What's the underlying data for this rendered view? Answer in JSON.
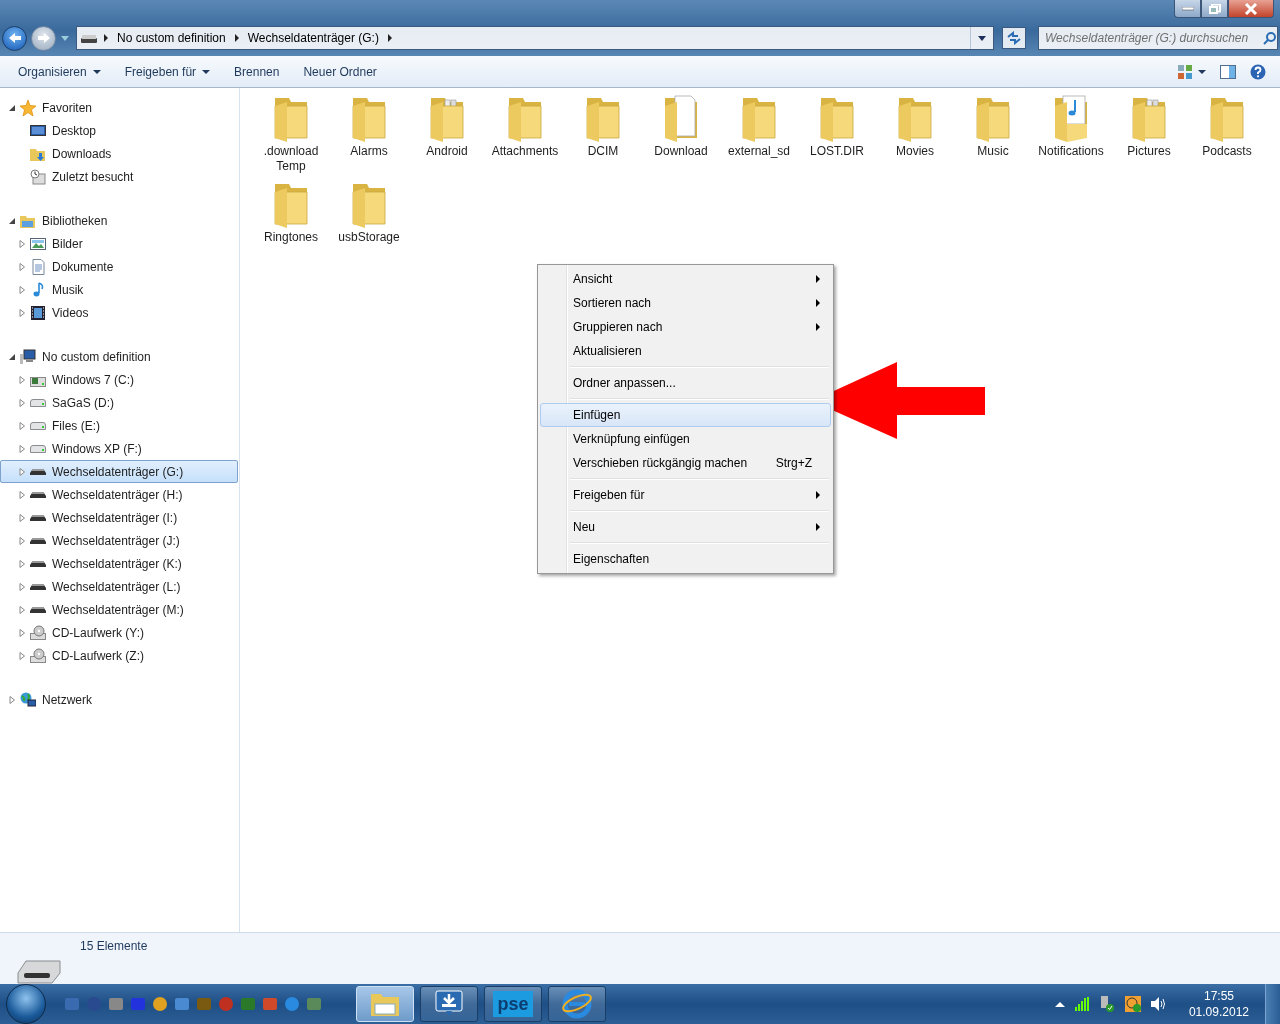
{
  "address_bar": {
    "segments": [
      "No custom definition",
      "Wechseldatenträger (G:)"
    ]
  },
  "search": {
    "placeholder": "Wechseldatenträger (G:) durchsuchen"
  },
  "toolbar": {
    "buttons": [
      {
        "label": "Organisieren",
        "dropdown": true
      },
      {
        "label": "Freigeben für",
        "dropdown": true
      },
      {
        "label": "Brennen",
        "dropdown": false
      },
      {
        "label": "Neuer Ordner",
        "dropdown": false
      }
    ]
  },
  "sidebar": {
    "groups": [
      {
        "label": "Favoriten",
        "kind": "star",
        "expanded": true,
        "selected": false,
        "children": [
          {
            "label": "Desktop",
            "kind": "desktop",
            "selected": false
          },
          {
            "label": "Downloads",
            "kind": "downloads",
            "selected": false
          },
          {
            "label": "Zuletzt besucht",
            "kind": "recent",
            "selected": false
          }
        ]
      },
      {
        "label": "Bibliotheken",
        "kind": "library",
        "expanded": true,
        "selected": false,
        "children": [
          {
            "label": "Bilder",
            "kind": "pictures",
            "expanded": false,
            "selected": false
          },
          {
            "label": "Dokumente",
            "kind": "documents",
            "expanded": false,
            "selected": false
          },
          {
            "label": "Musik",
            "kind": "music",
            "expanded": false,
            "selected": false
          },
          {
            "label": "Videos",
            "kind": "videos",
            "expanded": false,
            "selected": false
          }
        ]
      },
      {
        "label": "No custom definition",
        "kind": "computer",
        "expanded": true,
        "selected": false,
        "children": [
          {
            "label": "Windows 7 (C:)",
            "kind": "osdrive",
            "expanded": false,
            "selected": false
          },
          {
            "label": "SaGaS (D:)",
            "kind": "hdd",
            "expanded": false,
            "selected": false
          },
          {
            "label": "Files (E:)",
            "kind": "hdd",
            "expanded": false,
            "selected": false
          },
          {
            "label": "Windows XP (F:)",
            "kind": "hdd",
            "expanded": false,
            "selected": false
          },
          {
            "label": "Wechseldatenträger (G:)",
            "kind": "removable",
            "expanded": false,
            "selected": true
          },
          {
            "label": "Wechseldatenträger (H:)",
            "kind": "removable",
            "expanded": false,
            "selected": false
          },
          {
            "label": "Wechseldatenträger (I:)",
            "kind": "removable",
            "expanded": false,
            "selected": false
          },
          {
            "label": "Wechseldatenträger (J:)",
            "kind": "removable",
            "expanded": false,
            "selected": false
          },
          {
            "label": "Wechseldatenträger (K:)",
            "kind": "removable",
            "expanded": false,
            "selected": false
          },
          {
            "label": "Wechseldatenträger (L:)",
            "kind": "removable",
            "expanded": false,
            "selected": false
          },
          {
            "label": "Wechseldatenträger (M:)",
            "kind": "removable",
            "expanded": false,
            "selected": false
          },
          {
            "label": "CD-Laufwerk (Y:)",
            "kind": "cd",
            "expanded": false,
            "selected": false
          },
          {
            "label": "CD-Laufwerk (Z:)",
            "kind": "cd",
            "expanded": false,
            "selected": false
          }
        ]
      },
      {
        "label": "Netzwerk",
        "kind": "network",
        "expanded": false,
        "selected": false
      }
    ]
  },
  "files": [
    {
      "name": ".download Temp",
      "kind": "folder"
    },
    {
      "name": "Alarms",
      "kind": "folder"
    },
    {
      "name": "Android",
      "kind": "papers"
    },
    {
      "name": "Attachments",
      "kind": "folder"
    },
    {
      "name": "DCIM",
      "kind": "folder"
    },
    {
      "name": "Download",
      "kind": "document"
    },
    {
      "name": "external_sd",
      "kind": "folder"
    },
    {
      "name": "LOST.DIR",
      "kind": "folder"
    },
    {
      "name": "Movies",
      "kind": "folder"
    },
    {
      "name": "Music",
      "kind": "folder"
    },
    {
      "name": "Notifications",
      "kind": "music"
    },
    {
      "name": "Pictures",
      "kind": "papers"
    },
    {
      "name": "Podcasts",
      "kind": "folder"
    },
    {
      "name": "Ringtones",
      "kind": "folder"
    },
    {
      "name": "usbStorage",
      "kind": "folder"
    }
  ],
  "context_menu": {
    "items": [
      {
        "kind": "item",
        "label": "Ansicht",
        "submenu": true,
        "selected": false
      },
      {
        "kind": "item",
        "label": "Sortieren nach",
        "submenu": true,
        "selected": false
      },
      {
        "kind": "item",
        "label": "Gruppieren nach",
        "submenu": true,
        "selected": false
      },
      {
        "kind": "item",
        "label": "Aktualisieren",
        "submenu": false,
        "selected": false
      },
      {
        "kind": "separator"
      },
      {
        "kind": "item",
        "label": "Ordner anpassen...",
        "submenu": false,
        "selected": false
      },
      {
        "kind": "separator"
      },
      {
        "kind": "item",
        "label": "Einfügen",
        "submenu": false,
        "selected": true
      },
      {
        "kind": "item",
        "label": "Verknüpfung einfügen",
        "submenu": false,
        "selected": false
      },
      {
        "kind": "item",
        "label": "Verschieben rückgängig machen",
        "shortcut": "Strg+Z",
        "submenu": false,
        "selected": false
      },
      {
        "kind": "separator"
      },
      {
        "kind": "item",
        "label": "Freigeben für",
        "submenu": true,
        "selected": false
      },
      {
        "kind": "separator"
      },
      {
        "kind": "item",
        "label": "Neu",
        "submenu": true,
        "selected": false
      },
      {
        "kind": "separator"
      },
      {
        "kind": "item",
        "label": "Eigenschaften",
        "submenu": false,
        "selected": false
      }
    ]
  },
  "status_bar": {
    "count": "15 Elemente"
  },
  "taskbar": {
    "buttons": [
      {
        "kind": "explorer",
        "active": true
      },
      {
        "kind": "download",
        "active": false
      },
      {
        "kind": "pse",
        "label": "pse",
        "active": false
      },
      {
        "kind": "ie",
        "active": false
      }
    ],
    "clock": {
      "time": "17:55",
      "date": "01.09.2012"
    }
  }
}
